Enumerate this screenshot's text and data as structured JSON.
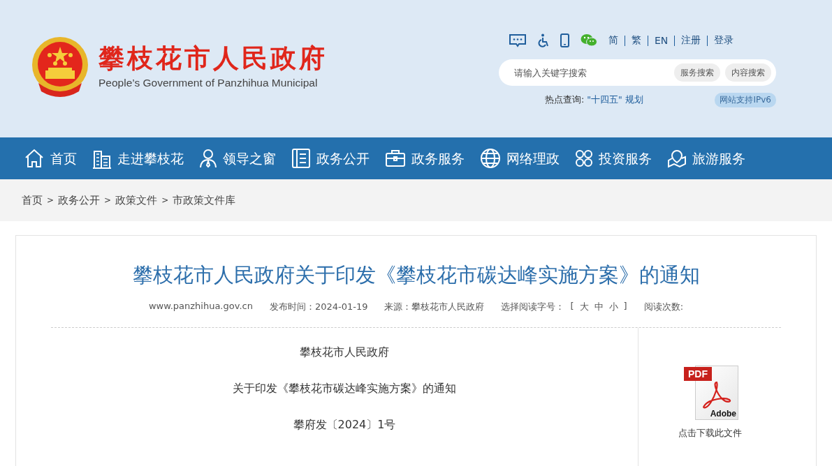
{
  "header": {
    "title": "攀枝花市人民政府",
    "subtitle": "People’s Government of Panzhihua Municipal",
    "tool_icons": [
      {
        "kind": "message"
      },
      {
        "kind": "accessibility"
      },
      {
        "kind": "mobile"
      },
      {
        "kind": "wechat"
      }
    ],
    "links": [
      "简",
      "繁",
      "EN",
      "注册",
      "登录"
    ],
    "search": {
      "placeholder": "请输入关键字搜索",
      "buttons": [
        "服务搜索",
        "内容搜索"
      ]
    },
    "hot": {
      "label": "热点查询:",
      "link": "\"十四五\" 规划"
    },
    "ipv6_badge": "网站支持IPv6"
  },
  "nav": [
    {
      "label": "首页",
      "kind": "home"
    },
    {
      "label": "走进攀枝花",
      "kind": "building"
    },
    {
      "label": "领导之窗",
      "kind": "person"
    },
    {
      "label": "政务公开",
      "kind": "document"
    },
    {
      "label": "政务服务",
      "kind": "briefcase"
    },
    {
      "label": "网络理政",
      "kind": "globe"
    },
    {
      "label": "投资服务",
      "kind": "clover"
    },
    {
      "label": "旅游服务",
      "kind": "map"
    }
  ],
  "breadcrumb": [
    "首页",
    "政务公开",
    "政策文件",
    "市政策文件库"
  ],
  "breadcrumb_separator": ">",
  "article": {
    "title": "攀枝花市人民政府关于印发《攀枝花市碳达峰实施方案》的通知",
    "site": "www.panzhihua.gov.cn",
    "published": {
      "label": "发布时间：",
      "value": "2024-01-19"
    },
    "source": {
      "label": "来源：",
      "value": "攀枝花市人民政府"
    },
    "font_size": {
      "label": "选择阅读字号：",
      "open": "[",
      "sizes": [
        "大",
        "中",
        "小"
      ],
      "close": "]"
    },
    "views": {
      "label": "阅读次数:"
    },
    "paragraphs": [
      "攀枝花市人民政府",
      "关于印发《攀枝花市碳达峰实施方案》的通知",
      "攀府发〔2024〕1号"
    ],
    "download": {
      "badge": "PDF",
      "brand": "Adobe",
      "label": "点击下载此文件"
    }
  }
}
